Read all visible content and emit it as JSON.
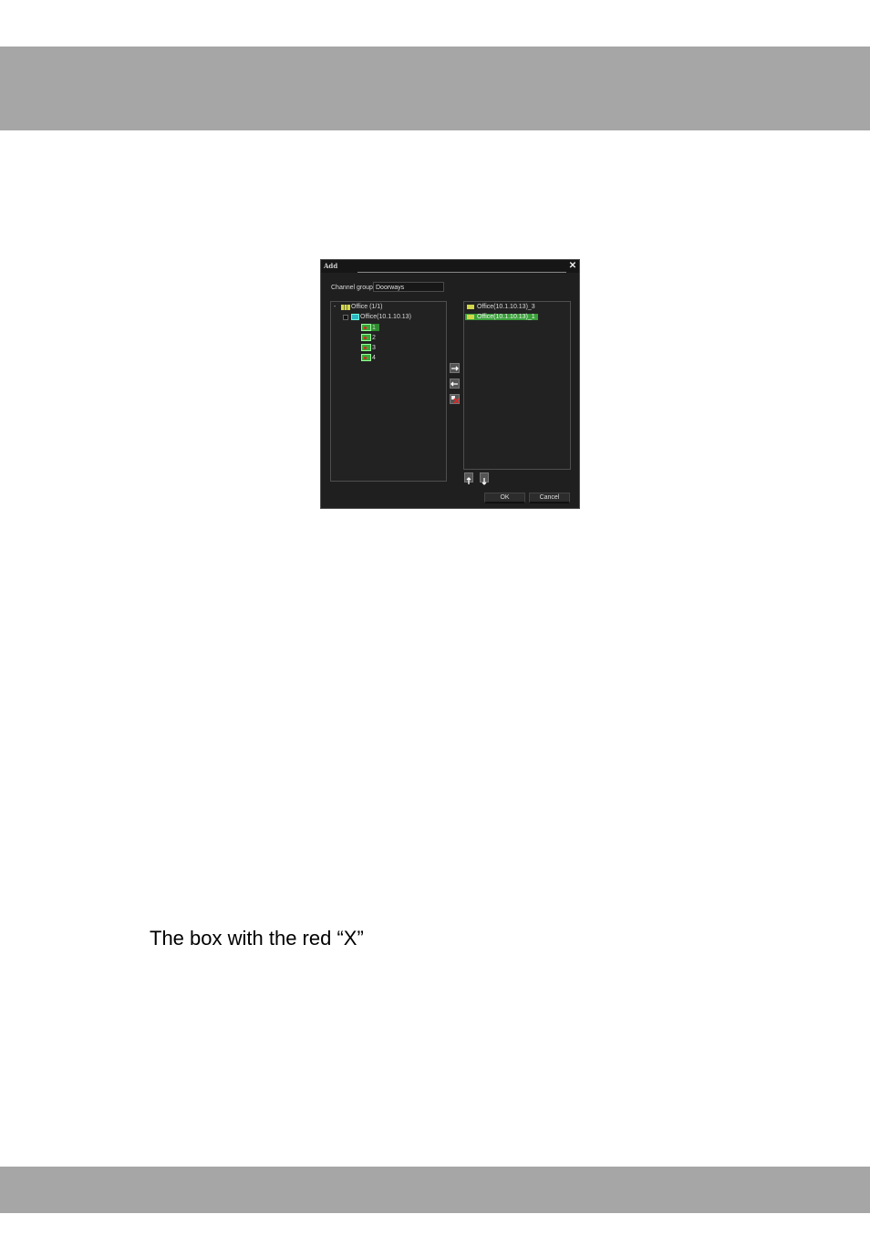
{
  "dialog": {
    "title": "Add",
    "close_glyph": "✕",
    "channel_group_label": "Channel group",
    "channel_group_value": "Doorways",
    "tree": {
      "root_label": "Office (1/1)",
      "device_label": "Office(10.1.10.13)",
      "channels": [
        "1",
        "2",
        "3",
        "4"
      ]
    },
    "selected_list": [
      {
        "label": "Office(10.1.10.13)_3",
        "selected": false
      },
      {
        "label": "Office(10.1.10.13)_1",
        "selected": true
      }
    ],
    "ok_label": "OK",
    "cancel_label": "Cancel",
    "icons": {
      "add": "arrow-right-icon",
      "remove": "arrow-left-icon",
      "clear": "clear-x-icon",
      "up": "arrow-up-icon",
      "down": "arrow-down-icon"
    }
  },
  "caption": "The box with the red “X”",
  "colors": {
    "band": "#a6a6a6",
    "dialog_bg": "#1f1f1f",
    "selection_green": "#3aa03a"
  }
}
